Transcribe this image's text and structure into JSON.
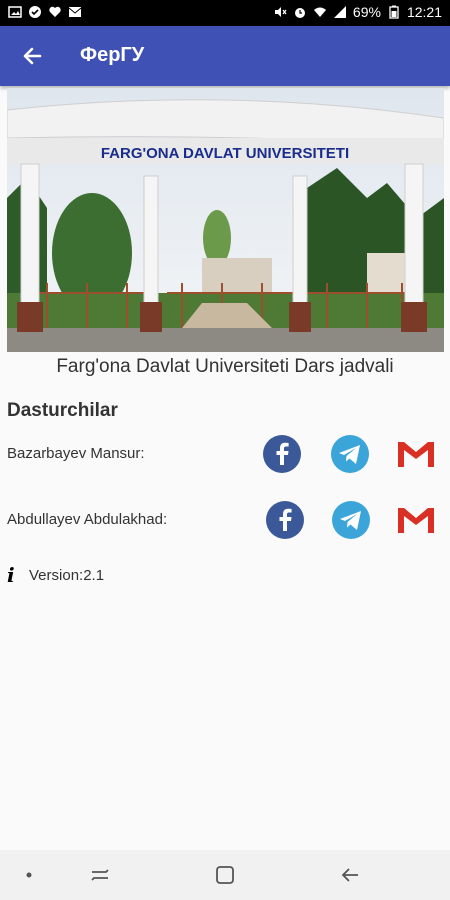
{
  "status_bar": {
    "battery": "69%",
    "time": "12:21"
  },
  "app_bar": {
    "title": "ФерГУ"
  },
  "banner": {
    "sign_text": "FARG'ONA DAVLAT UNIVERSITETI"
  },
  "caption": "Farg'ona Davlat Universiteti Dars jadvali",
  "developers": {
    "title": "Dasturchilar",
    "items": [
      {
        "name": "Bazarbayev Mansur:"
      },
      {
        "name": "Abdullayev Abdulakhad:"
      }
    ]
  },
  "version": {
    "text": "Version:2.1"
  },
  "colors": {
    "primary": "#3f51b5",
    "facebook": "#3b5998",
    "telegram": "#3ba5d9",
    "gmail": "#d93025"
  }
}
